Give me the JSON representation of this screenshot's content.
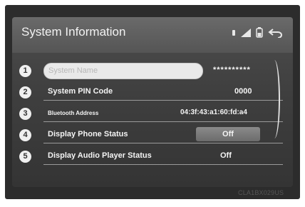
{
  "screen": {
    "title": "System Information",
    "rows": [
      {
        "number": "1",
        "label": "System Name",
        "value": "**********"
      },
      {
        "number": "2",
        "label": "System PIN Code",
        "value": "0000"
      },
      {
        "number": "3",
        "label": "Bluetooth Address",
        "value": "04:3f:43:a1:60:fd:a4"
      },
      {
        "number": "4",
        "label": "Display Phone Status",
        "value": "Off"
      },
      {
        "number": "5",
        "label": "Display Audio Player Status",
        "value": "Off"
      }
    ]
  },
  "image_code": "CLA1BX029US"
}
